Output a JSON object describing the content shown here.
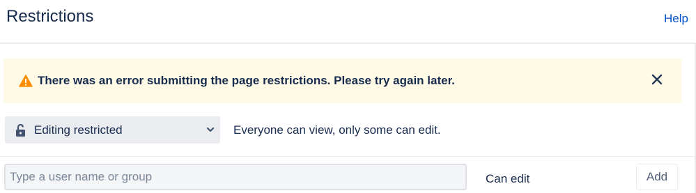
{
  "header": {
    "title": "Restrictions",
    "help_label": "Help"
  },
  "banner": {
    "icon": "warning-icon",
    "message": "There was an error submitting the page restrictions. Please try again later.",
    "close_icon": "close-icon"
  },
  "restriction": {
    "selected": "Editing restricted",
    "icon": "unlock-icon",
    "description": "Everyone can view, only some can edit."
  },
  "add_user": {
    "placeholder": "Type a user name or group",
    "value": "",
    "permission": "Can edit",
    "add_label": "Add"
  },
  "colors": {
    "link": "#0052cc",
    "warning_bg": "#fffae6",
    "warning_icon": "#ff8b00",
    "text": "#172b4d"
  }
}
